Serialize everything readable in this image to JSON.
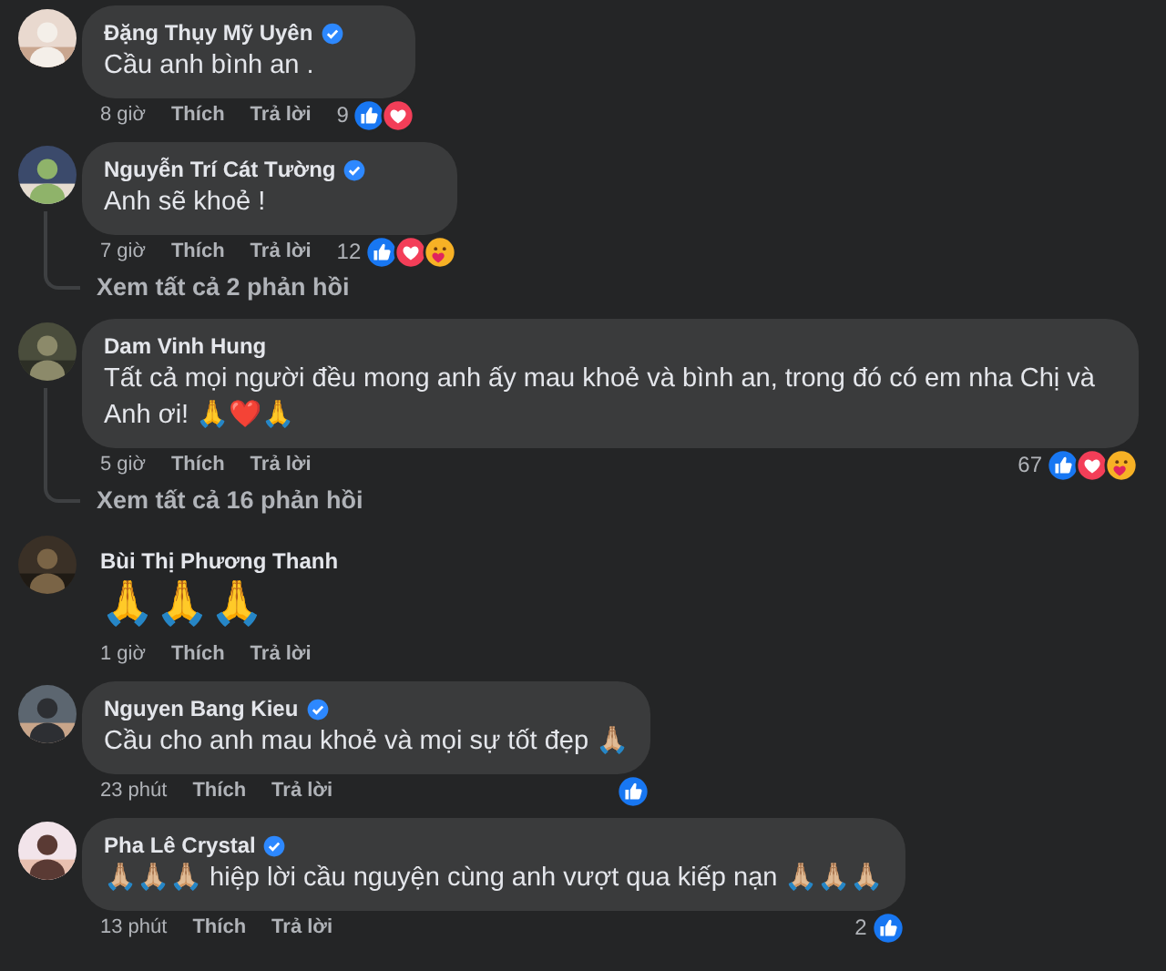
{
  "comments": [
    {
      "kind": "bubble",
      "name": "Đặng Thụy Mỹ Uyên",
      "verified": true,
      "text": "Cầu anh bình an .",
      "time": "8 giờ",
      "like": "Thích",
      "reply": "Trả lời",
      "reaction_count": "9",
      "reactions": [
        {
          "kind": "like"
        },
        {
          "kind": "love"
        }
      ]
    },
    {
      "kind": "bubble",
      "name": "Nguyễn Trí Cát Tường",
      "verified": true,
      "text": "Anh sẽ khoẻ !",
      "time": "7 giờ",
      "like": "Thích",
      "reply": "Trả lời",
      "reaction_count": "12",
      "reactions": [
        {
          "kind": "like"
        },
        {
          "kind": "love"
        },
        {
          "kind": "care"
        }
      ],
      "view_replies": "Xem tất cả 2 phản hồi"
    },
    {
      "kind": "bubble",
      "name": "Dam Vinh Hung",
      "text": "Tất cả mọi người đều mong anh ấy mau khoẻ và bình an, trong đó có em nha Chị và Anh ơi! 🙏❤️🙏",
      "time": "5 giờ",
      "like": "Thích",
      "reply": "Trả lời",
      "reaction_count": "67",
      "reactions": [
        {
          "kind": "like"
        },
        {
          "kind": "love"
        },
        {
          "kind": "care"
        }
      ],
      "view_replies": "Xem tất cả 16 phản hồi"
    },
    {
      "kind": "plain",
      "name": "Bùi Thị Phương Thanh",
      "text": "🙏🙏🙏",
      "time": "1 giờ",
      "like": "Thích",
      "reply": "Trả lời"
    },
    {
      "kind": "bubble",
      "name": "Nguyen Bang Kieu",
      "verified": true,
      "text": "Cầu cho anh mau khoẻ và mọi sự tốt đẹp 🙏🏼",
      "time": "23 phút",
      "like": "Thích",
      "reply": "Trả lời",
      "reactions": [
        {
          "kind": "like"
        }
      ]
    },
    {
      "kind": "bubble",
      "name": "Pha Lê Crystal",
      "verified": true,
      "text": "🙏🏼🙏🏼🙏🏼 hiệp lời cầu nguyện cùng anh vượt qua kiếp nạn 🙏🏼🙏🏼🙏🏼",
      "time": "13 phút",
      "like": "Thích",
      "reply": "Trả lời",
      "reaction_count": "2",
      "reactions": [
        {
          "kind": "like"
        }
      ]
    }
  ]
}
